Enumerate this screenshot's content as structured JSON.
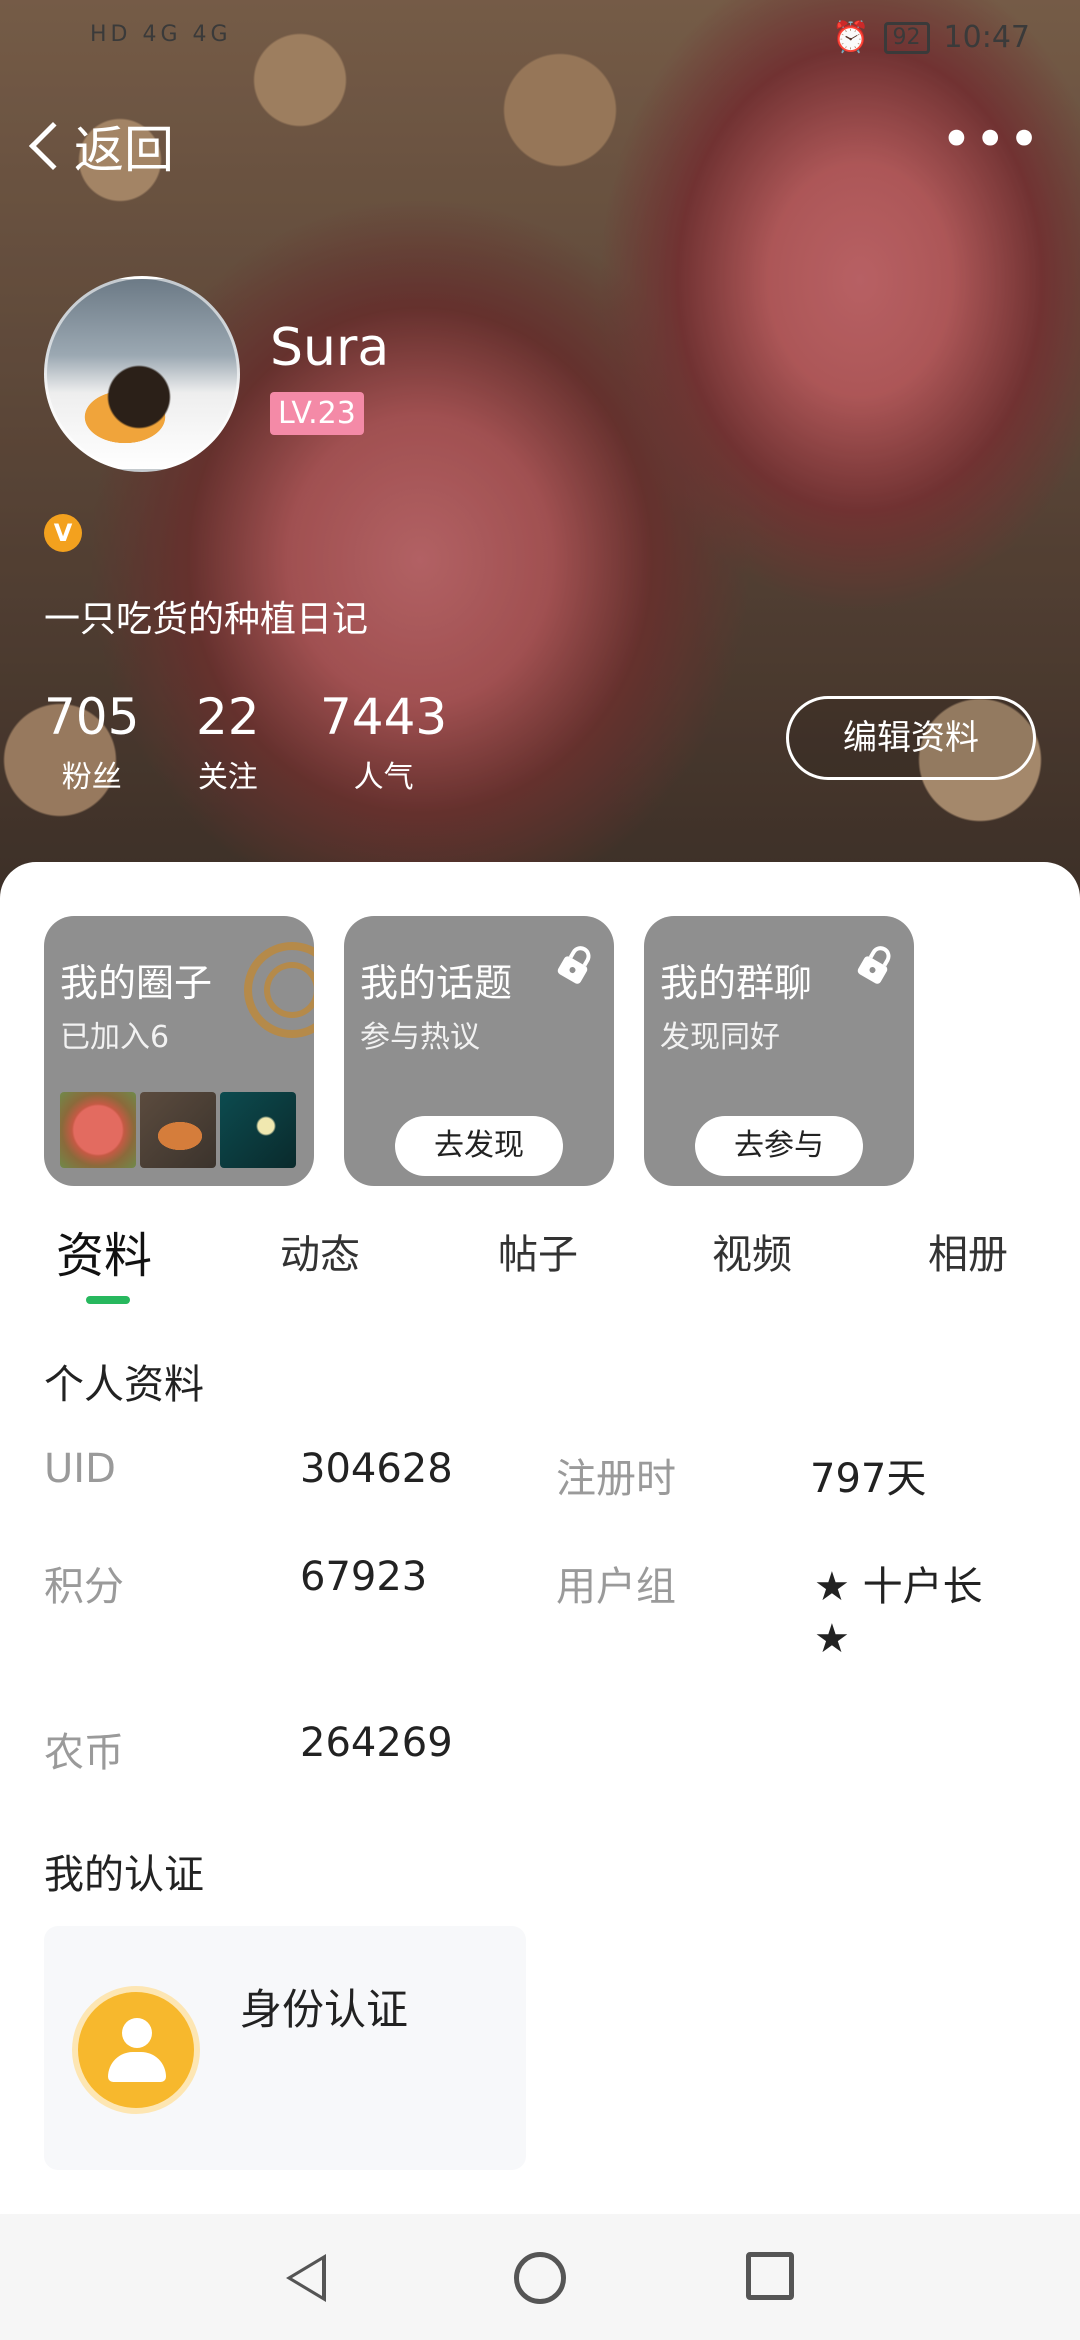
{
  "status_bar": {
    "left_indicators": "HD 4G 4G",
    "battery": "92",
    "time": "10:47"
  },
  "nav": {
    "back_label": "返回",
    "more_label": "•••"
  },
  "profile": {
    "username": "Sura",
    "level": "LV.23",
    "bio": "一只吃货的种植日记",
    "badge": "V",
    "edit_label": "编辑资料",
    "stats": [
      {
        "value": "705",
        "label": "粉丝"
      },
      {
        "value": "22",
        "label": "关注"
      },
      {
        "value": "7443",
        "label": "人气"
      }
    ]
  },
  "cards": [
    {
      "title": "我的圈子",
      "subtitle": "已加入6"
    },
    {
      "title": "我的话题",
      "subtitle": "参与热议",
      "button": "去发现"
    },
    {
      "title": "我的群聊",
      "subtitle": "发现同好",
      "button": "去参与"
    }
  ],
  "tabs": [
    "资料",
    "动态",
    "帖子",
    "视频",
    "相册"
  ],
  "personal_info": {
    "title": "个人资料",
    "uid_label": "UID",
    "uid_value": "304628",
    "register_label": "注册时",
    "register_value": "797天",
    "points_label": "积分",
    "points_value": "67923",
    "group_label": "用户组",
    "group_value_line1": "★ 十户长",
    "group_value_line2": "★",
    "coins_label": "农币",
    "coins_value": "264269"
  },
  "certification": {
    "title": "我的认证",
    "item_label": "身份认证"
  },
  "colors": {
    "accent_green": "#27b85e",
    "level_pink": "#f48aa7",
    "badge_orange": "#f3a11e",
    "card_gray": "#8f8f8f"
  }
}
